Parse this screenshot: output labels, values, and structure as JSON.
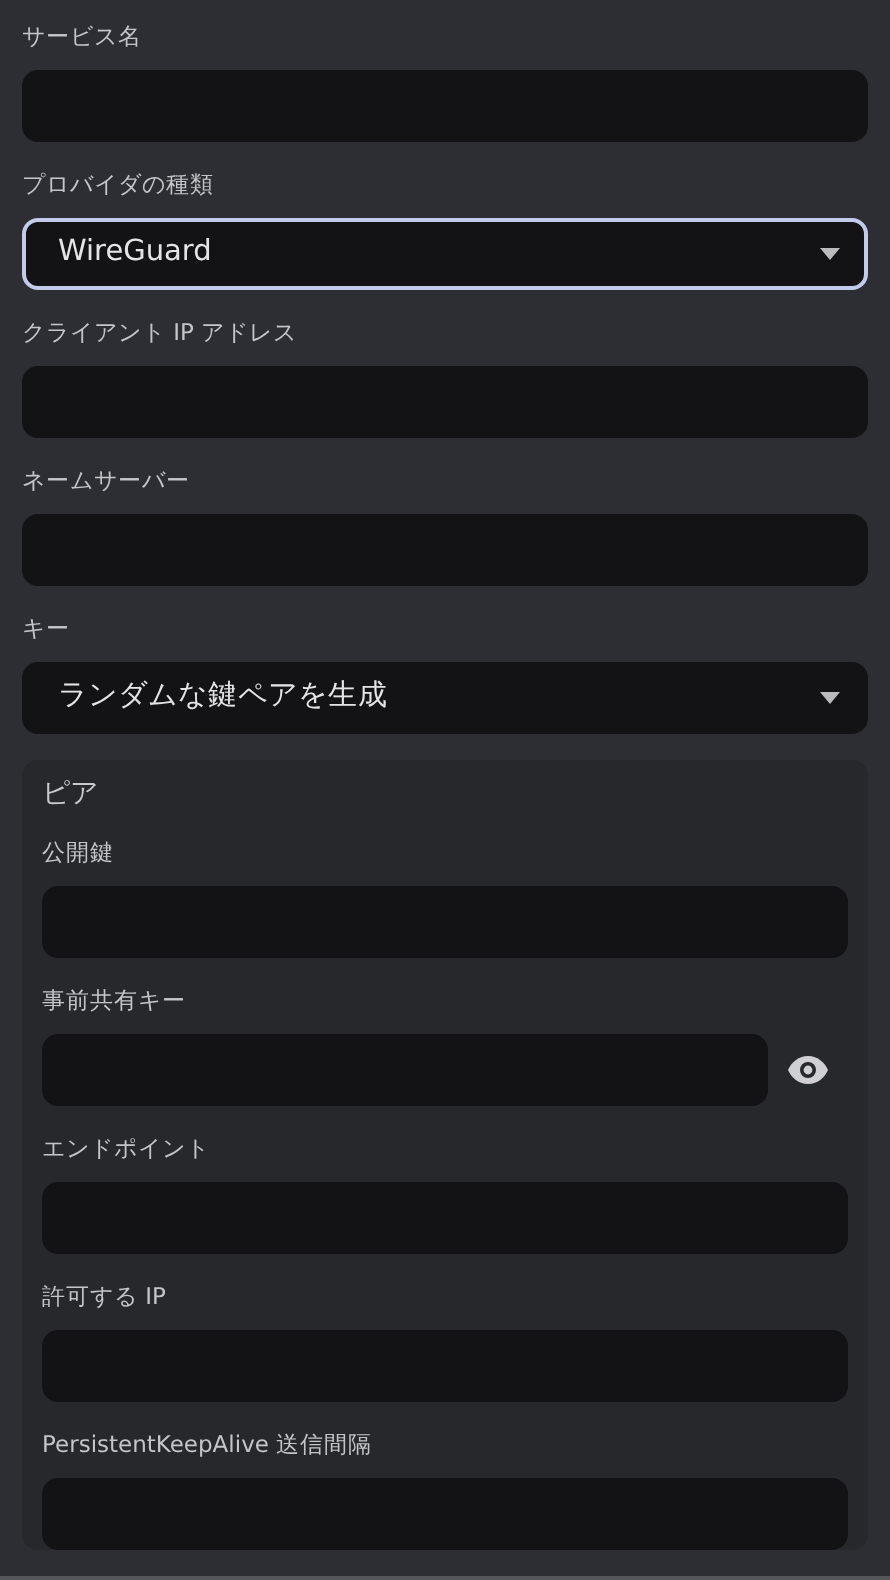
{
  "fields": [
    {
      "kind": "text",
      "label": "サービス名",
      "focused": false
    },
    {
      "kind": "select",
      "label": "プロバイダの種類",
      "value": "WireGuard",
      "focused": true
    },
    {
      "kind": "text",
      "label": "クライアント IP アドレス",
      "focused": false
    },
    {
      "kind": "text",
      "label": "ネームサーバー",
      "focused": false
    },
    {
      "kind": "select",
      "label": "キー",
      "value": "ランダムな鍵ペアを生成",
      "focused": false
    }
  ],
  "peer": {
    "title": "ピア",
    "fields": [
      {
        "kind": "text",
        "label": "公開鍵"
      },
      {
        "kind": "password",
        "label": "事前共有キー"
      },
      {
        "kind": "text",
        "label": "エンドポイント"
      },
      {
        "kind": "text",
        "label": "許可する IP"
      },
      {
        "kind": "text",
        "label": "PersistentKeepAlive 送信間隔"
      }
    ]
  }
}
